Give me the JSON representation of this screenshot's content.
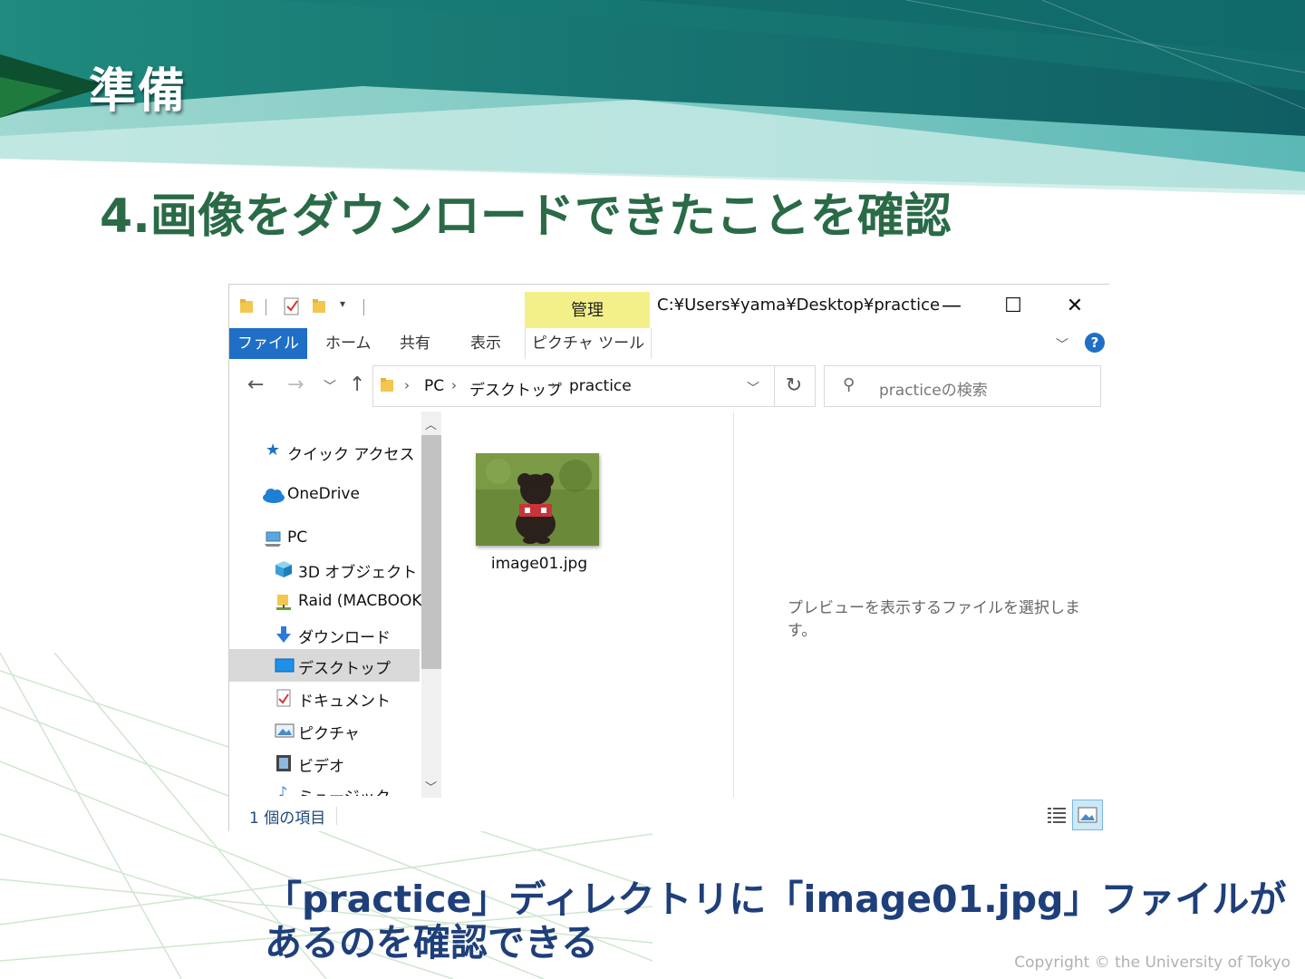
{
  "slide": {
    "heading": "準備",
    "step_title": "4.画像をダウンロードできたことを確認",
    "caption_line1": "「practice」ディレクトリに「image01.jpg」ファイルが",
    "caption_line2": "あるのを確認できる",
    "copyright": "Copyright © the University of Tokyo"
  },
  "explorer": {
    "contextual_tab": "管理",
    "window_path": "C:¥Users¥yama¥Desktop¥practice",
    "ribbon_tabs": [
      "ファイル",
      "ホーム",
      "共有",
      "表示",
      "ピクチャ ツール"
    ],
    "breadcrumb": [
      "PC",
      "デスクトップ",
      "practice"
    ],
    "search_placeholder": "practiceの検索",
    "nav_items": [
      {
        "label": "クイック アクセス",
        "icon": "star-icon"
      },
      {
        "label": "OneDrive",
        "icon": "cloud-icon"
      },
      {
        "label": "PC",
        "icon": "computer-icon"
      },
      {
        "label": "3D オブジェクト",
        "icon": "cube-icon"
      },
      {
        "label": "Raid (MACBOOK",
        "icon": "network-drive-icon"
      },
      {
        "label": "ダウンロード",
        "icon": "download-icon"
      },
      {
        "label": "デスクトップ",
        "icon": "desktop-icon",
        "selected": true
      },
      {
        "label": "ドキュメント",
        "icon": "document-icon"
      },
      {
        "label": "ピクチャ",
        "icon": "pictures-icon"
      },
      {
        "label": "ビデオ",
        "icon": "video-icon"
      },
      {
        "label": "ミュージック",
        "icon": "music-icon"
      }
    ],
    "file": {
      "name": "image01.jpg"
    },
    "preview_message": "プレビューを表示するファイルを選択します。",
    "status": "1 個の項目",
    "colors": {
      "file_tab": "#1e6fc5",
      "manage_tab": "#f3f08a",
      "heading": "#2a6a47",
      "caption": "#1e3f7a"
    }
  }
}
